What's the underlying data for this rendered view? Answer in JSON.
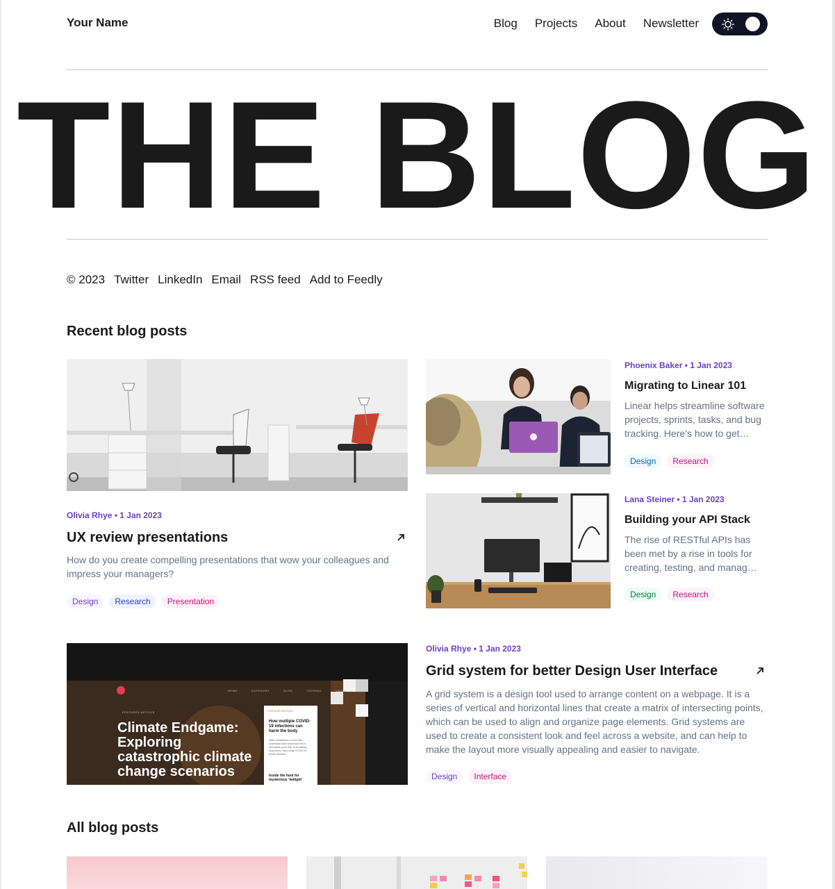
{
  "header": {
    "brand": "Your Name",
    "nav": [
      "Blog",
      "Projects",
      "About",
      "Newsletter"
    ],
    "theme_toggle": "light"
  },
  "hero": {
    "title": "THE BLOG"
  },
  "social": [
    "© 2023",
    "Twitter",
    "LinkedIn",
    "Email",
    "RSS feed",
    "Add to Feedly"
  ],
  "recent": {
    "heading": "Recent blog posts",
    "posts": [
      {
        "meta": "Olivia Rhye • 1 Jan 2023",
        "title": "UX review presentations",
        "excerpt": "How do you create compelling presentations that wow your colleagues and impress your managers?",
        "tags": [
          "Design",
          "Research",
          "Presentation"
        ]
      },
      {
        "meta": "Phoenix Baker • 1 Jan 2023",
        "title": "Migrating to Linear 101",
        "excerpt": "Linear helps streamline software projects, sprints, tasks, and bug tracking. Here’s how to get…",
        "tags": [
          "Design",
          "Research"
        ]
      },
      {
        "meta": "Lana Steiner • 1 Jan 2023",
        "title": "Building your API Stack",
        "excerpt": "The rise of RESTful APIs has been met by a rise in tools for creating, testing, and manag…",
        "tags": [
          "Design",
          "Research"
        ]
      },
      {
        "meta": "Olivia Rhye • 1 Jan 2023",
        "title": "Grid system for better Design User Interface",
        "excerpt": "A grid system is a design tool used to arrange content on a webpage. It is a series of vertical and horizontal lines that create a matrix of intersecting points, which can be used to align and organize page elements. Grid systems are used to create a consistent look and feel across a website, and can help to make the layout more visually appealing and easier to navigate.",
        "tags": [
          "Design",
          "Interface"
        ],
        "image_text": {
          "headline": "Climate Endgame: Exploring catastrophic climate change scenarios",
          "label": "FEATURED ARTICLE",
          "nav": [
            "HOME",
            "CATEGORY",
            "BLOG",
            "JOURNAL",
            "LOGIN"
          ],
          "popular_label": "POPULAR ARTICLE",
          "popular_title": "How multiple COVID-19 infections can harm the body",
          "popular_body": "With restrictions on the rise, scientists warn that each bout increases your risk of troubling outcomes, from long COVID to heart disease.",
          "popular_next": "Inside the hunt for mysterious ‘twilight’"
        }
      }
    ]
  },
  "all": {
    "heading": "All blog posts"
  },
  "colors": {
    "accent": "#6941c6",
    "text": "#1a1a1a",
    "muted": "#667085",
    "toggle_bg": "#0f1324"
  }
}
